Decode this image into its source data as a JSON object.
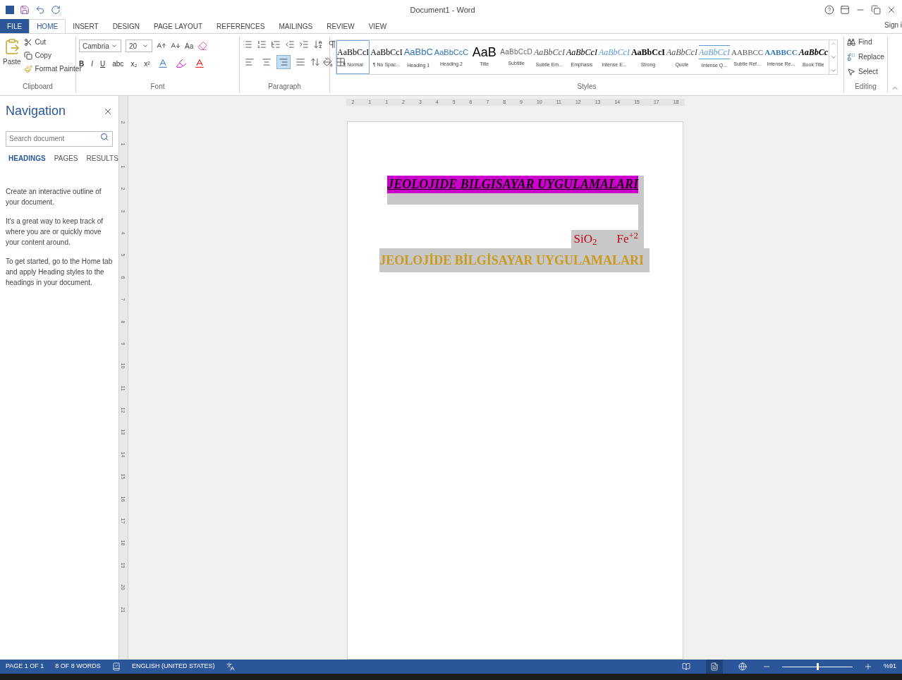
{
  "window": {
    "title": "Document1 - Word",
    "sign_in": "Sign i"
  },
  "ribbon_tabs": [
    {
      "label": "FILE",
      "kind": "file",
      "selected": false
    },
    {
      "label": "HOME",
      "kind": "tab",
      "selected": true
    },
    {
      "label": "INSERT",
      "kind": "tab",
      "selected": false
    },
    {
      "label": "DESIGN",
      "kind": "tab",
      "selected": false
    },
    {
      "label": "PAGE LAYOUT",
      "kind": "tab",
      "selected": false
    },
    {
      "label": "REFERENCES",
      "kind": "tab",
      "selected": false
    },
    {
      "label": "MAILINGS",
      "kind": "tab",
      "selected": false
    },
    {
      "label": "REVIEW",
      "kind": "tab",
      "selected": false
    },
    {
      "label": "VIEW",
      "kind": "tab",
      "selected": false
    }
  ],
  "clipboard": {
    "paste": "Paste",
    "cut": "Cut",
    "copy": "Copy",
    "format_painter": "Format Painter",
    "label": "Clipboard"
  },
  "font": {
    "name": "Cambria",
    "size": "20",
    "change_case": "Aa",
    "format_buttons": [
      "B",
      "I",
      "U",
      "abc",
      "x₂",
      "x²"
    ],
    "label": "Font"
  },
  "paragraph": {
    "label": "Paragraph",
    "alignments": [
      {
        "kind": "left",
        "selected": false
      },
      {
        "kind": "center",
        "selected": false
      },
      {
        "kind": "right",
        "selected": true
      },
      {
        "kind": "justify",
        "selected": false
      }
    ]
  },
  "styles": {
    "label": "Styles",
    "items": [
      {
        "preview": "AaBbCcI",
        "name": "¶ Normal",
        "kind": "plain",
        "selected": true
      },
      {
        "preview": "AaBbCcI",
        "name": "¶ No Spac...",
        "kind": "plain",
        "selected": false
      },
      {
        "preview": "AaBbC",
        "name": "Heading 1",
        "kind": "heading",
        "selected": false
      },
      {
        "preview": "AaBbCcC",
        "name": "Heading 2",
        "kind": "heading-small",
        "selected": false
      },
      {
        "preview": "AaB",
        "name": "Title",
        "kind": "title",
        "selected": false
      },
      {
        "preview": "AaBbCcD",
        "name": "Subtitle",
        "kind": "subtitle",
        "selected": false
      },
      {
        "preview": "AaBbCcI",
        "name": "Subtle Em...",
        "kind": "italic",
        "selected": false
      },
      {
        "preview": "AaBbCcI",
        "name": "Emphasis",
        "kind": "italic-dark",
        "selected": false
      },
      {
        "preview": "AaBbCcI",
        "name": "Intense E...",
        "kind": "italic-blue",
        "selected": false
      },
      {
        "preview": "AaBbCcI",
        "name": "Strong",
        "kind": "bold",
        "selected": false
      },
      {
        "preview": "AaBbCcI",
        "name": "Quote",
        "kind": "italic",
        "selected": false
      },
      {
        "preview": "AaBbCcI",
        "name": "Intense Q...",
        "kind": "quote-blue",
        "selected": false
      },
      {
        "preview": "AABBCC",
        "name": "Subtle Ref...",
        "kind": "smallcaps",
        "selected": false
      },
      {
        "preview": "AABBCC",
        "name": "Intense Re...",
        "kind": "smallcaps-blue",
        "selected": false
      },
      {
        "preview": "AaBbCc",
        "name": "Book Title",
        "kind": "bold-italic",
        "selected": false
      }
    ]
  },
  "editing": {
    "find": "Find",
    "replace": "Replace",
    "select": "Select",
    "label": "Editing"
  },
  "navigation": {
    "title": "Navigation",
    "search_placeholder": "Search document",
    "tabs": [
      {
        "label": "HEADINGS",
        "selected": true
      },
      {
        "label": "PAGES",
        "selected": false
      },
      {
        "label": "RESULTS",
        "selected": false
      }
    ],
    "paragraphs": [
      "Create an interactive outline of your document.",
      "It's a great way to keep track of where you are or quickly move your content around.",
      "To get started, go to the Home tab and apply Heading styles to the headings in your document."
    ]
  },
  "horizontal_ruler": [
    "2",
    "1",
    "1",
    "2",
    "3",
    "4",
    "5",
    "6",
    "7",
    "8",
    "9",
    "10",
    "11",
    "12",
    "13",
    "14",
    "15",
    "17",
    "18"
  ],
  "vertical_ruler": [
    "2",
    "1",
    "1",
    "2",
    "3",
    "4",
    "5",
    "6",
    "7",
    "8",
    "9",
    "10",
    "11",
    "12",
    "13",
    "14",
    "15",
    "16",
    "17",
    "18",
    "19",
    "20",
    "21"
  ],
  "document": {
    "lines": [
      {
        "kind": "title",
        "text": "JEOLOJIDE BILGISAYAR UYGULAMALARI",
        "color": "#1a0010",
        "highlight": {
          "color": "#cc00cc"
        }
      },
      {
        "kind": "formula",
        "parts": [
          "SiO$_{2}$",
          "Fe$^{+2}$"
        ],
        "color": "#c0001a"
      },
      {
        "kind": "heading",
        "text": "JEOLOJİDE BİLGİSAYAR UYGULAMALARI",
        "color": "#c99a1e"
      }
    ]
  },
  "status_bar": {
    "page": "PAGE 1 OF 1",
    "words": "8 OF 8 WORDS",
    "language": "ENGLISH (UNITED STATES)",
    "zoom": "%91",
    "zoom_slider": {
      "level": 0.5
    },
    "views": [
      {
        "kind": "read",
        "selected": false
      },
      {
        "kind": "print",
        "selected": true
      },
      {
        "kind": "web",
        "selected": false
      }
    ]
  }
}
